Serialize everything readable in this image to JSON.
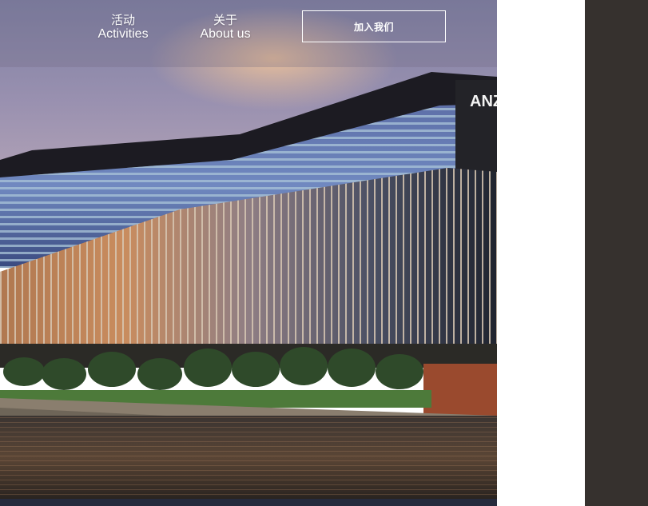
{
  "nav": {
    "items": [
      {
        "zh": "活动",
        "en": "Activities"
      },
      {
        "zh": "关于",
        "en": "About us"
      }
    ],
    "join_label": "加入我们"
  },
  "hero": {
    "image": "building-waterfront-photo",
    "sign_text": "ANZ"
  },
  "colors": {
    "right_panel": "#36312e",
    "bottom_strip": "#262b3d",
    "nav_text": "#ffffff"
  }
}
